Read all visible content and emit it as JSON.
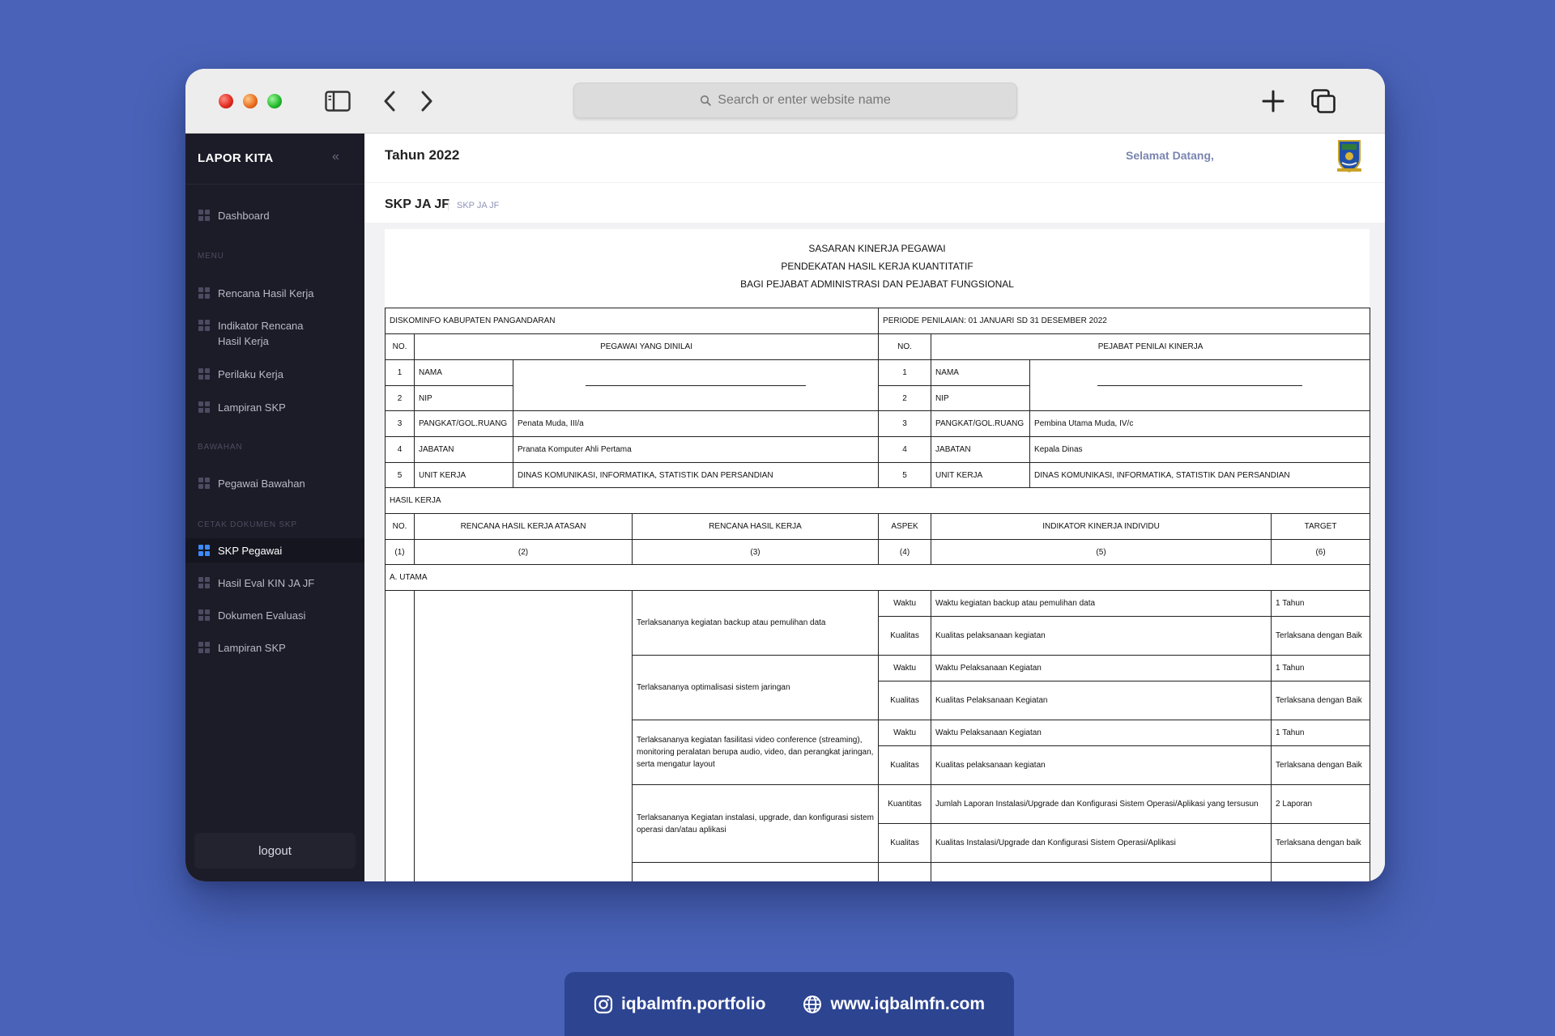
{
  "browser": {
    "search_placeholder": "Search or enter website name"
  },
  "sidebar": {
    "brand": "LAPOR KITA",
    "collapse_glyph": "«",
    "dashboard": "Dashboard",
    "section_menu": "MENU",
    "menu_items": [
      "Rencana Hasil Kerja",
      "Indikator Rencana Hasil Kerja",
      "Perilaku Kerja",
      "Lampiran SKP"
    ],
    "section_bawahan": "BAWAHAN",
    "bawahan_items": [
      "Pegawai Bawahan"
    ],
    "section_cetak": "CETAK DOKUMEN SKP",
    "cetak_items": [
      "SKP Pegawai",
      "Hasil Eval KIN JA JF",
      "Dokumen Evaluasi",
      "Lampiran SKP"
    ],
    "logout": "logout",
    "active_color": "#3d8bff"
  },
  "header": {
    "year": "Tahun 2022",
    "welcome": "Selamat Datang,",
    "page_title": "SKP JA JF",
    "breadcrumb": "SKP JA JF"
  },
  "document": {
    "title_lines": [
      "SASARAN KINERJA PEGAWAI",
      "PENDEKATAN HASIL KERJA KUANTITATIF",
      "BAGI PEJABAT ADMINISTRASI DAN PEJABAT FUNGSIONAL"
    ],
    "instansi": "DISKOMINFO KABUPATEN PANGANDARAN",
    "periode": "PERIODE PENILAIAN: 01 JANUARI SD 31 DESEMBER 2022",
    "no_label": "NO.",
    "pegawai_header": "PEGAWAI YANG DINILAI",
    "pejabat_header": "PEJABAT PENILAI KINERJA",
    "pegawai_rows": [
      {
        "no": "1",
        "label": "NAMA",
        "value": ""
      },
      {
        "no": "2",
        "label": "NIP",
        "value": ""
      },
      {
        "no": "3",
        "label": "PANGKAT/GOL.RUANG",
        "value": "Penata Muda, III/a"
      },
      {
        "no": "4",
        "label": "JABATAN",
        "value": "Pranata Komputer Ahli Pertama"
      },
      {
        "no": "5",
        "label": "UNIT KERJA",
        "value": "DINAS KOMUNIKASI, INFORMATIKA, STATISTIK DAN PERSANDIAN"
      }
    ],
    "pejabat_rows": [
      {
        "no": "1",
        "label": "NAMA",
        "value": ""
      },
      {
        "no": "2",
        "label": "NIP",
        "value": ""
      },
      {
        "no": "3",
        "label": "PANGKAT/GOL.RUANG",
        "value": "Pembina Utama Muda, IV/c"
      },
      {
        "no": "4",
        "label": "JABATAN",
        "value": "Kepala Dinas"
      },
      {
        "no": "5",
        "label": "UNIT KERJA",
        "value": "DINAS KOMUNIKASI, INFORMATIKA, STATISTIK DAN PERSANDIAN"
      }
    ],
    "hasil_kerja_label": "HASIL KERJA",
    "hk_headers": [
      "NO.",
      "RENCANA HASIL KERJA ATASAN",
      "RENCANA HASIL KERJA",
      "ASPEK",
      "INDIKATOR KINERJA INDIVIDU",
      "TARGET"
    ],
    "hk_numbers": [
      "(1)",
      "(2)",
      "(3)",
      "(4)",
      "(5)",
      "(6)"
    ],
    "utama_label": "A. UTAMA",
    "rhk": [
      {
        "text": "Terlaksananya kegiatan backup atau pemulihan data",
        "rows": [
          {
            "aspek": "Waktu",
            "indikator": "Waktu kegiatan backup atau pemulihan data",
            "target": "1 Tahun"
          },
          {
            "aspek": "Kualitas",
            "indikator": "Kualitas pelaksanaan kegiatan",
            "target": "Terlaksana dengan Baik"
          }
        ]
      },
      {
        "text": "Terlaksananya optimalisasi sistem jaringan",
        "rows": [
          {
            "aspek": "Waktu",
            "indikator": "Waktu Pelaksanaan Kegiatan",
            "target": "1 Tahun"
          },
          {
            "aspek": "Kualitas",
            "indikator": "Kualitas Pelaksanaan Kegiatan",
            "target": "Terlaksana dengan Baik"
          }
        ]
      },
      {
        "text": "Terlaksananya kegiatan fasilitasi video conference (streaming), monitoring peralatan berupa audio, video, dan perangkat jaringan, serta mengatur layout",
        "rows": [
          {
            "aspek": "Waktu",
            "indikator": "Waktu Pelaksanaan Kegiatan",
            "target": "1 Tahun"
          },
          {
            "aspek": "Kualitas",
            "indikator": "Kualitas pelaksanaan kegiatan",
            "target": "Terlaksana dengan Baik"
          }
        ]
      },
      {
        "text": "Terlaksananya Kegiatan instalasi, upgrade, dan konfigurasi sistem operasi dan/atau aplikasi",
        "rows": [
          {
            "aspek": "Kuantitas",
            "indikator": "Jumlah Laporan Instalasi/Upgrade dan Konfigurasi Sistem Operasi/Aplikasi yang tersusun",
            "target": "2 Laporan"
          },
          {
            "aspek": "Kualitas",
            "indikator": "Kualitas Instalasi/Upgrade dan Konfigurasi Sistem Operasi/Aplikasi",
            "target": "Terlaksana dengan baik"
          }
        ]
      }
    ]
  },
  "footer": {
    "instagram": "iqbalmfn.portfolio",
    "website": "www.iqbalmfn.com"
  }
}
